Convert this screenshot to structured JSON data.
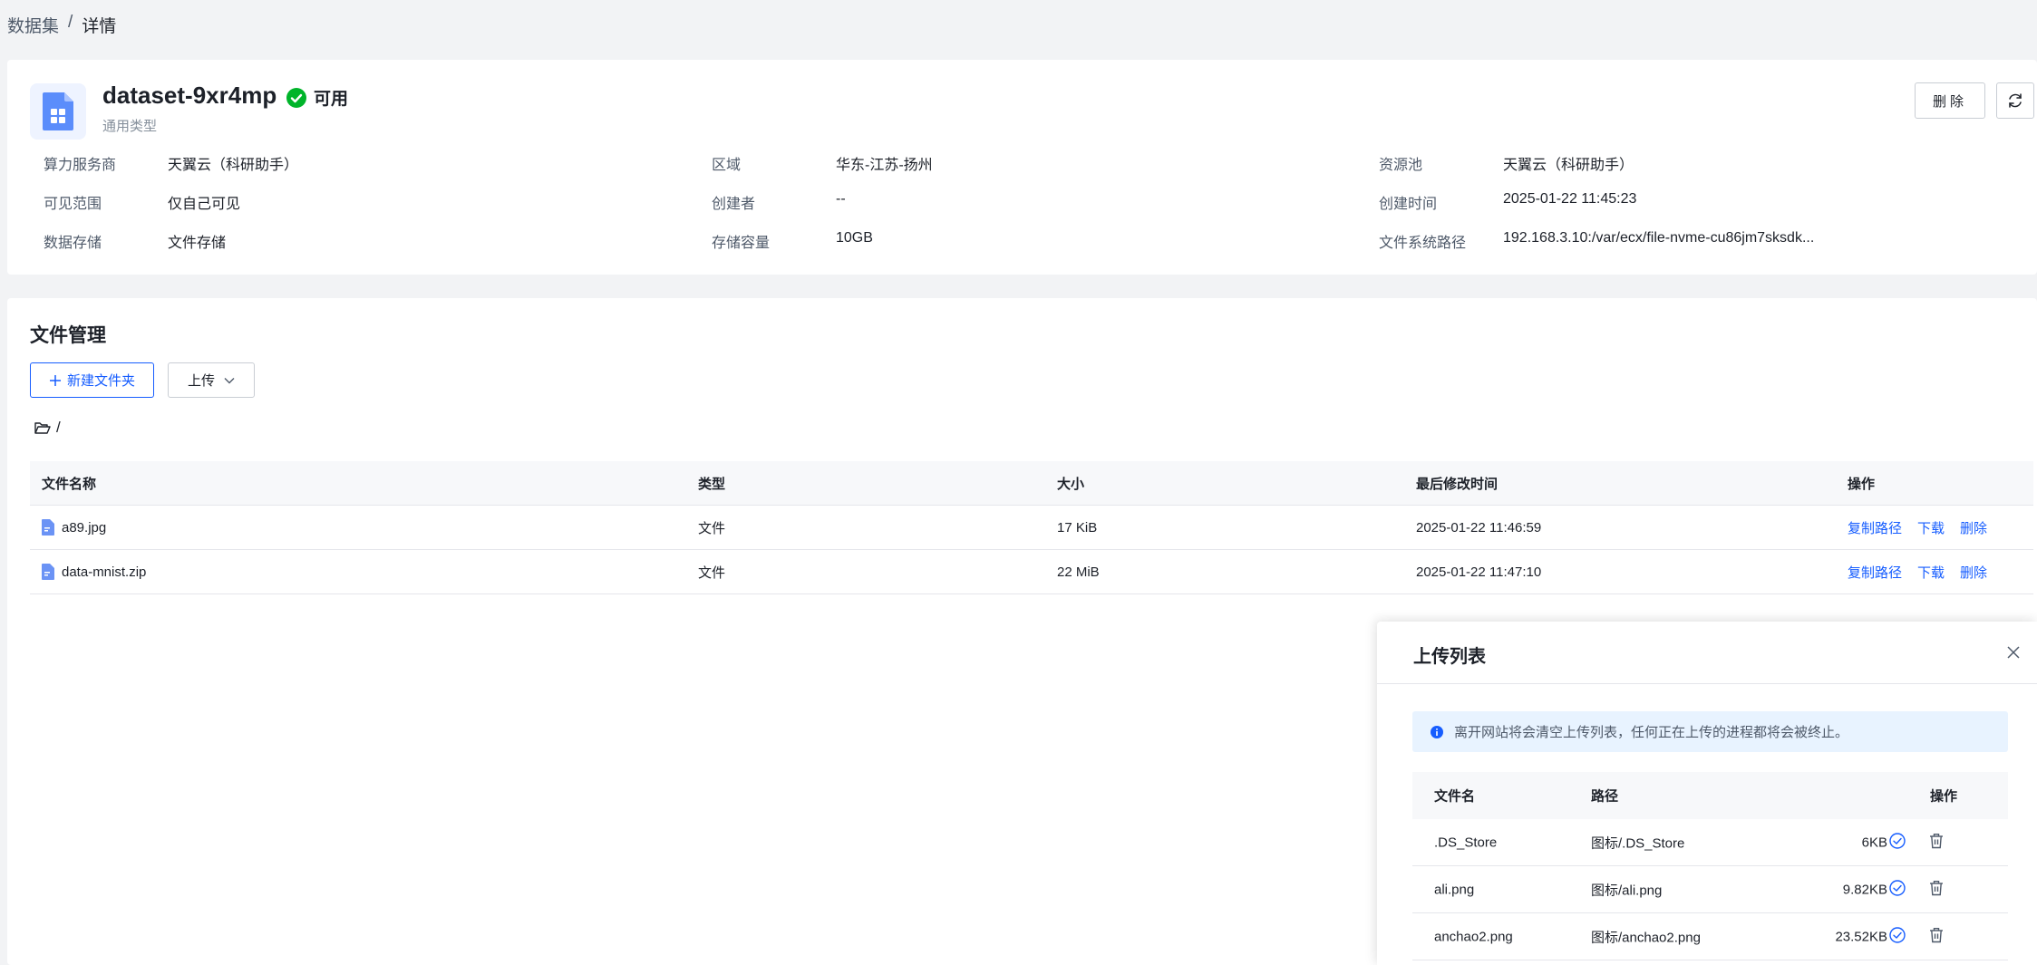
{
  "breadcrumb": {
    "root": "数据集",
    "separator": "/",
    "current": "详情"
  },
  "dataset": {
    "name": "dataset-9xr4mp",
    "status": "可用",
    "type": "通用类型",
    "delete_label": "删除"
  },
  "info": {
    "provider_label": "算力服务商",
    "provider_value": "天翼云（科研助手）",
    "region_label": "区域",
    "region_value": "华东-江苏-扬州",
    "pool_label": "资源池",
    "pool_value": "天翼云（科研助手）",
    "visibility_label": "可见范围",
    "visibility_value": "仅自己可见",
    "creator_label": "创建者",
    "creator_value": "--",
    "created_label": "创建时间",
    "created_value": "2025-01-22 11:45:23",
    "storage_label": "数据存储",
    "storage_value": "文件存储",
    "capacity_label": "存储容量",
    "capacity_value": "10GB",
    "fspath_label": "文件系统路径",
    "fspath_value": "192.168.3.10:/var/ecx/file-nvme-cu86jm7sksdk..."
  },
  "files": {
    "title": "文件管理",
    "new_folder_label": "新建文件夹",
    "upload_label": "上传",
    "path": "/",
    "columns": {
      "name": "文件名称",
      "type": "类型",
      "size": "大小",
      "modified": "最后修改时间",
      "ops": "操作"
    },
    "rows": [
      {
        "name": "a89.jpg",
        "type": "文件",
        "size": "17 KiB",
        "modified": "2025-01-22 11:46:59",
        "copy": "复制路径",
        "download": "下载",
        "delete": "删除"
      },
      {
        "name": "data-mnist.zip",
        "type": "文件",
        "size": "22 MiB",
        "modified": "2025-01-22 11:47:10",
        "copy": "复制路径",
        "download": "下载",
        "delete": "删除"
      }
    ]
  },
  "upload_panel": {
    "title": "上传列表",
    "notice": "离开网站将会清空上传列表，任何正在上传的进程都将会被终止。",
    "columns": {
      "name": "文件名",
      "path": "路径",
      "ops": "操作"
    },
    "rows": [
      {
        "name": ".DS_Store",
        "path": "图标/.DS_Store",
        "size": "6KB"
      },
      {
        "name": "ali.png",
        "path": "图标/ali.png",
        "size": "9.82KB"
      },
      {
        "name": "anchao2.png",
        "path": "图标/anchao2.png",
        "size": "23.52KB"
      }
    ]
  },
  "colors": {
    "primary": "#165dff",
    "success": "#00b42a",
    "background": "#f2f3f5"
  }
}
